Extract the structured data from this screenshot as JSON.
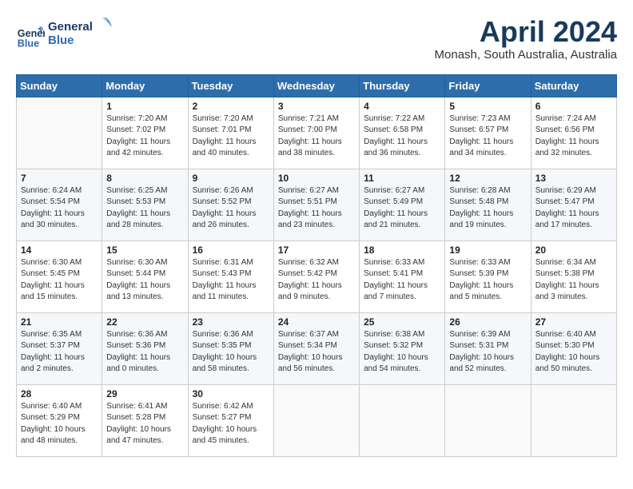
{
  "header": {
    "logo_line1": "General",
    "logo_line2": "Blue",
    "month_year": "April 2024",
    "location": "Monash, South Australia, Australia"
  },
  "days_of_week": [
    "Sunday",
    "Monday",
    "Tuesday",
    "Wednesday",
    "Thursday",
    "Friday",
    "Saturday"
  ],
  "weeks": [
    [
      {
        "num": "",
        "sunrise": "",
        "sunset": "",
        "daylight": ""
      },
      {
        "num": "1",
        "sunrise": "Sunrise: 7:20 AM",
        "sunset": "Sunset: 7:02 PM",
        "daylight": "Daylight: 11 hours and 42 minutes."
      },
      {
        "num": "2",
        "sunrise": "Sunrise: 7:20 AM",
        "sunset": "Sunset: 7:01 PM",
        "daylight": "Daylight: 11 hours and 40 minutes."
      },
      {
        "num": "3",
        "sunrise": "Sunrise: 7:21 AM",
        "sunset": "Sunset: 7:00 PM",
        "daylight": "Daylight: 11 hours and 38 minutes."
      },
      {
        "num": "4",
        "sunrise": "Sunrise: 7:22 AM",
        "sunset": "Sunset: 6:58 PM",
        "daylight": "Daylight: 11 hours and 36 minutes."
      },
      {
        "num": "5",
        "sunrise": "Sunrise: 7:23 AM",
        "sunset": "Sunset: 6:57 PM",
        "daylight": "Daylight: 11 hours and 34 minutes."
      },
      {
        "num": "6",
        "sunrise": "Sunrise: 7:24 AM",
        "sunset": "Sunset: 6:56 PM",
        "daylight": "Daylight: 11 hours and 32 minutes."
      }
    ],
    [
      {
        "num": "7",
        "sunrise": "Sunrise: 6:24 AM",
        "sunset": "Sunset: 5:54 PM",
        "daylight": "Daylight: 11 hours and 30 minutes."
      },
      {
        "num": "8",
        "sunrise": "Sunrise: 6:25 AM",
        "sunset": "Sunset: 5:53 PM",
        "daylight": "Daylight: 11 hours and 28 minutes."
      },
      {
        "num": "9",
        "sunrise": "Sunrise: 6:26 AM",
        "sunset": "Sunset: 5:52 PM",
        "daylight": "Daylight: 11 hours and 26 minutes."
      },
      {
        "num": "10",
        "sunrise": "Sunrise: 6:27 AM",
        "sunset": "Sunset: 5:51 PM",
        "daylight": "Daylight: 11 hours and 23 minutes."
      },
      {
        "num": "11",
        "sunrise": "Sunrise: 6:27 AM",
        "sunset": "Sunset: 5:49 PM",
        "daylight": "Daylight: 11 hours and 21 minutes."
      },
      {
        "num": "12",
        "sunrise": "Sunrise: 6:28 AM",
        "sunset": "Sunset: 5:48 PM",
        "daylight": "Daylight: 11 hours and 19 minutes."
      },
      {
        "num": "13",
        "sunrise": "Sunrise: 6:29 AM",
        "sunset": "Sunset: 5:47 PM",
        "daylight": "Daylight: 11 hours and 17 minutes."
      }
    ],
    [
      {
        "num": "14",
        "sunrise": "Sunrise: 6:30 AM",
        "sunset": "Sunset: 5:45 PM",
        "daylight": "Daylight: 11 hours and 15 minutes."
      },
      {
        "num": "15",
        "sunrise": "Sunrise: 6:30 AM",
        "sunset": "Sunset: 5:44 PM",
        "daylight": "Daylight: 11 hours and 13 minutes."
      },
      {
        "num": "16",
        "sunrise": "Sunrise: 6:31 AM",
        "sunset": "Sunset: 5:43 PM",
        "daylight": "Daylight: 11 hours and 11 minutes."
      },
      {
        "num": "17",
        "sunrise": "Sunrise: 6:32 AM",
        "sunset": "Sunset: 5:42 PM",
        "daylight": "Daylight: 11 hours and 9 minutes."
      },
      {
        "num": "18",
        "sunrise": "Sunrise: 6:33 AM",
        "sunset": "Sunset: 5:41 PM",
        "daylight": "Daylight: 11 hours and 7 minutes."
      },
      {
        "num": "19",
        "sunrise": "Sunrise: 6:33 AM",
        "sunset": "Sunset: 5:39 PM",
        "daylight": "Daylight: 11 hours and 5 minutes."
      },
      {
        "num": "20",
        "sunrise": "Sunrise: 6:34 AM",
        "sunset": "Sunset: 5:38 PM",
        "daylight": "Daylight: 11 hours and 3 minutes."
      }
    ],
    [
      {
        "num": "21",
        "sunrise": "Sunrise: 6:35 AM",
        "sunset": "Sunset: 5:37 PM",
        "daylight": "Daylight: 11 hours and 2 minutes."
      },
      {
        "num": "22",
        "sunrise": "Sunrise: 6:36 AM",
        "sunset": "Sunset: 5:36 PM",
        "daylight": "Daylight: 11 hours and 0 minutes."
      },
      {
        "num": "23",
        "sunrise": "Sunrise: 6:36 AM",
        "sunset": "Sunset: 5:35 PM",
        "daylight": "Daylight: 10 hours and 58 minutes."
      },
      {
        "num": "24",
        "sunrise": "Sunrise: 6:37 AM",
        "sunset": "Sunset: 5:34 PM",
        "daylight": "Daylight: 10 hours and 56 minutes."
      },
      {
        "num": "25",
        "sunrise": "Sunrise: 6:38 AM",
        "sunset": "Sunset: 5:32 PM",
        "daylight": "Daylight: 10 hours and 54 minutes."
      },
      {
        "num": "26",
        "sunrise": "Sunrise: 6:39 AM",
        "sunset": "Sunset: 5:31 PM",
        "daylight": "Daylight: 10 hours and 52 minutes."
      },
      {
        "num": "27",
        "sunrise": "Sunrise: 6:40 AM",
        "sunset": "Sunset: 5:30 PM",
        "daylight": "Daylight: 10 hours and 50 minutes."
      }
    ],
    [
      {
        "num": "28",
        "sunrise": "Sunrise: 6:40 AM",
        "sunset": "Sunset: 5:29 PM",
        "daylight": "Daylight: 10 hours and 48 minutes."
      },
      {
        "num": "29",
        "sunrise": "Sunrise: 6:41 AM",
        "sunset": "Sunset: 5:28 PM",
        "daylight": "Daylight: 10 hours and 47 minutes."
      },
      {
        "num": "30",
        "sunrise": "Sunrise: 6:42 AM",
        "sunset": "Sunset: 5:27 PM",
        "daylight": "Daylight: 10 hours and 45 minutes."
      },
      {
        "num": "",
        "sunrise": "",
        "sunset": "",
        "daylight": ""
      },
      {
        "num": "",
        "sunrise": "",
        "sunset": "",
        "daylight": ""
      },
      {
        "num": "",
        "sunrise": "",
        "sunset": "",
        "daylight": ""
      },
      {
        "num": "",
        "sunrise": "",
        "sunset": "",
        "daylight": ""
      }
    ]
  ]
}
